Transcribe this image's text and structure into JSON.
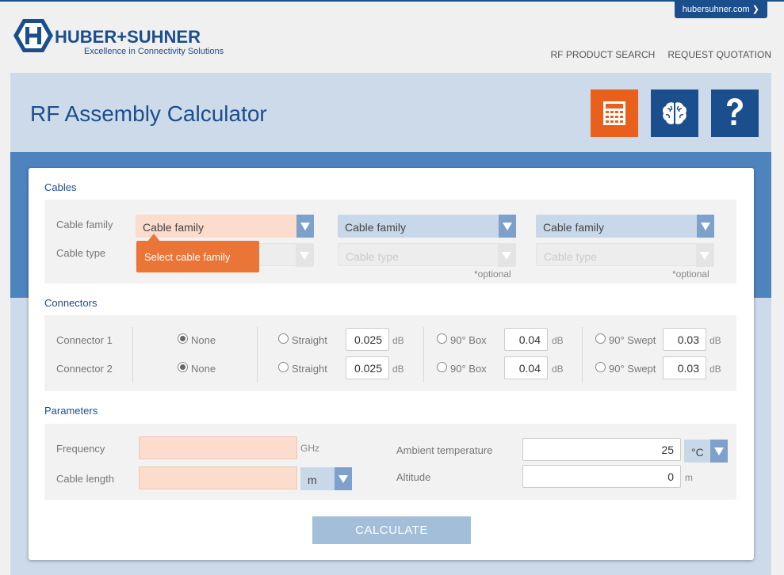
{
  "topbar": {
    "site_link": "hubersuhner.com ❯"
  },
  "brand": {
    "name": "HUBER+SUHNER",
    "tagline": "Excellence in Connectivity Solutions"
  },
  "nav": {
    "items": [
      "RF PRODUCT SEARCH",
      "REQUEST QUOTATION"
    ]
  },
  "hero": {
    "title": "RF Assembly Calculator",
    "tools": [
      {
        "icon": "calculator-icon",
        "color": "#e8601c"
      },
      {
        "icon": "brain-icon",
        "color": "#1b4e8c"
      },
      {
        "icon": "question-icon",
        "color": "#1b4e8c"
      }
    ]
  },
  "cables": {
    "title": "Cables",
    "family_label": "Cable family",
    "type_label": "Cable type",
    "family_placeholder": "Cable family",
    "type_placeholder": "Cable type",
    "optional": "*optional",
    "tooltip": "Select cable family"
  },
  "connectors": {
    "title": "Connectors",
    "rows": [
      {
        "label": "Connector 1",
        "none": "None",
        "straight": "Straight",
        "straight_db": "0.025",
        "box": "90° Box",
        "box_db": "0.04",
        "swept": "90° Swept",
        "swept_db": "0.03"
      },
      {
        "label": "Connector 2",
        "none": "None",
        "straight": "Straight",
        "straight_db": "0.025",
        "box": "90° Box",
        "box_db": "0.04",
        "swept": "90° Swept",
        "swept_db": "0.03"
      }
    ],
    "unit": "dB"
  },
  "parameters": {
    "title": "Parameters",
    "frequency_label": "Frequency",
    "frequency_unit": "GHz",
    "length_label": "Cable length",
    "length_unit": "m",
    "ambient_label": "Ambient temperature",
    "ambient_value": "25",
    "ambient_unit": "°C",
    "altitude_label": "Altitude",
    "altitude_value": "0",
    "altitude_unit": "m"
  },
  "actions": {
    "calculate": "CALCULATE"
  }
}
